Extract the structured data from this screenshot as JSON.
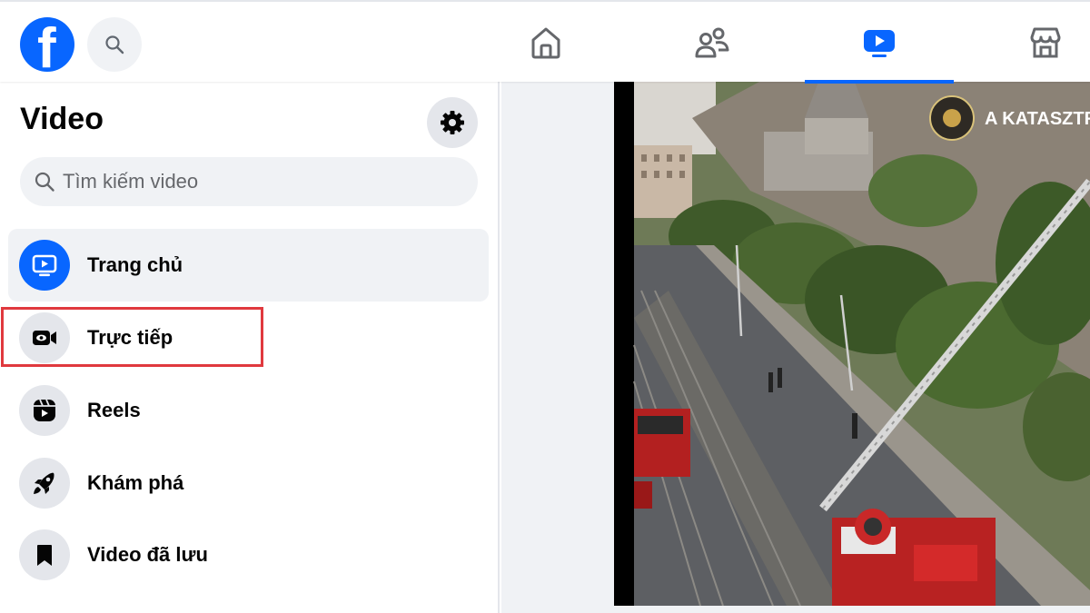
{
  "topbar": {
    "logo_letter": "f",
    "nav_tabs": [
      "home",
      "friends",
      "video",
      "marketplace"
    ],
    "active_tab": "video",
    "accent_color": "#0866ff"
  },
  "sidebar": {
    "title": "Video",
    "search_placeholder": "Tìm kiếm video",
    "items": [
      {
        "label": "Trang chủ",
        "icon": "play-screen-icon",
        "selected": true
      },
      {
        "label": "Trực tiếp",
        "icon": "live-camera-icon",
        "highlighted": true
      },
      {
        "label": "Reels",
        "icon": "reels-icon"
      },
      {
        "label": "Khám phá",
        "icon": "rocket-icon"
      },
      {
        "label": "Video đã lưu",
        "icon": "bookmark-icon"
      }
    ]
  },
  "video": {
    "watermark": "A KATASZTR",
    "highlight_color": "#e0393e"
  }
}
